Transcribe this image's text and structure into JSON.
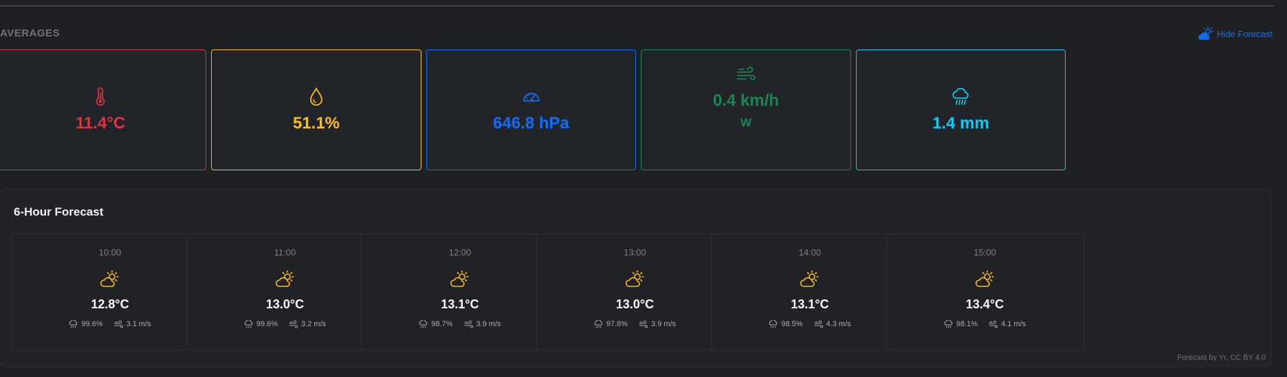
{
  "section_title": "AVERAGES",
  "hide_forecast_label": "Hide Forecast",
  "averages": [
    {
      "icon": "thermometer-icon",
      "value": "11.4°C",
      "sub": "",
      "color": "#dc3545"
    },
    {
      "icon": "droplet-icon",
      "value": "51.1%",
      "sub": "",
      "color": "#ffc107"
    },
    {
      "icon": "speedometer-icon",
      "value": "646.8 hPa",
      "sub": "",
      "color": "#0d6efd"
    },
    {
      "icon": "wind-icon",
      "value": "0.4 km/h",
      "sub": "W",
      "color": "#198754"
    },
    {
      "icon": "cloud-rain-icon",
      "value": "1.4 mm",
      "sub": "",
      "color": "#0dcaf0"
    }
  ],
  "forecast": {
    "title": "6-Hour Forecast",
    "items": [
      {
        "time": "10:00",
        "temp": "12.8°C",
        "humidity": "99.6%",
        "wind": "3.1 m/s"
      },
      {
        "time": "11:00",
        "temp": "13.0°C",
        "humidity": "99.6%",
        "wind": "3.2 m/s"
      },
      {
        "time": "12:00",
        "temp": "13.1°C",
        "humidity": "98.7%",
        "wind": "3.9 m/s"
      },
      {
        "time": "13:00",
        "temp": "13.0°C",
        "humidity": "97.8%",
        "wind": "3.9 m/s"
      },
      {
        "time": "14:00",
        "temp": "13.1°C",
        "humidity": "98.5%",
        "wind": "4.3 m/s"
      },
      {
        "time": "15:00",
        "temp": "13.4°C",
        "humidity": "98.1%",
        "wind": "4.1 m/s"
      }
    ],
    "credit": "Forecast by Yr, CC BY 4.0"
  },
  "colors": {
    "accent": "#0d6efd",
    "sun_icon": "#ffc107"
  }
}
